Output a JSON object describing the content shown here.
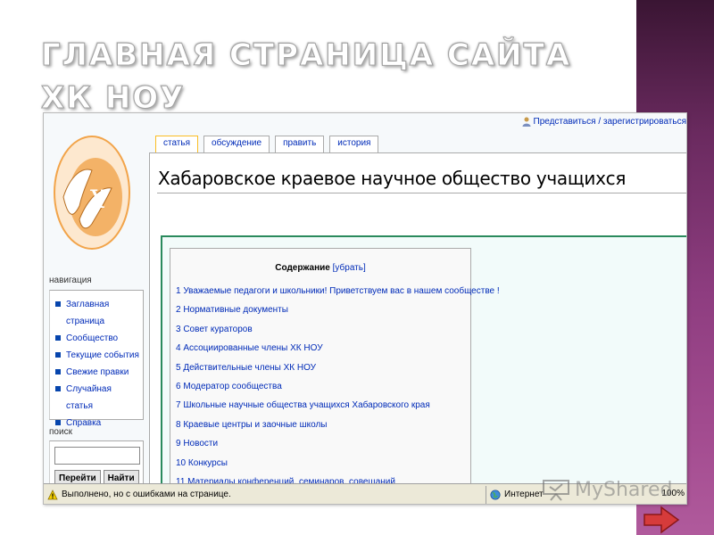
{
  "slide": {
    "title_line1": "ГЛАВНАЯ СТРАНИЦА САЙТА",
    "title_line2": "ХК НОУ",
    "accent": "#8e3d80"
  },
  "wiki": {
    "user_links": "Представиться / зарегистрироваться",
    "tabs": [
      "статья",
      "обсуждение",
      "править",
      "история"
    ],
    "page_title": "Хабаровское краевое научное общество учащихся",
    "logo_text": "Х"
  },
  "sidebar": {
    "navigation_heading": "навигация",
    "items": [
      {
        "label": "Заглавная страница"
      },
      {
        "label": "Сообщество"
      },
      {
        "label": "Текущие события"
      },
      {
        "label": "Свежие правки"
      },
      {
        "label": "Случайная статья"
      },
      {
        "label": "Справка"
      }
    ],
    "search_heading": "поиск",
    "go_button": "Перейти",
    "search_button": "Найти"
  },
  "toc": {
    "title": "Содержание",
    "toggle": "[убрать]",
    "items": [
      "1 Уважаемые педагоги и школьники! Приветствуем вас в нашем сообществе !",
      "2 Нормативные документы",
      "3 Совет кураторов",
      "4 Ассоциированные члены ХК НОУ",
      "5 Действительные члены ХК НОУ",
      "6 Модератор сообщества",
      "7 Школьные научные общества учащихся Хабаровского края",
      "8 Краевые центры и заочные школы",
      "9 Новости",
      "10 Конкурсы",
      "11 Материалы конференций, семинаров, совещаний"
    ]
  },
  "status_bar": {
    "message": "Выполнено, но с ошибками на странице.",
    "zone": "Интернет",
    "zoom": "100%"
  },
  "watermark": "MyShared"
}
